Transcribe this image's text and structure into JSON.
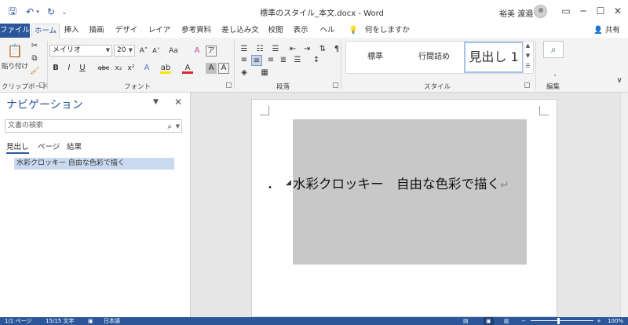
{
  "titlebar": {
    "title": "標準のスタイル_本文.docx  -  Word",
    "user": "裕美 渡邉",
    "min": "─",
    "max": "☐",
    "close": "✕",
    "qat_save": "🖫",
    "qat_undo": "↶",
    "qat_redo": "↻",
    "qat_more": "⌄"
  },
  "tabs": {
    "file": "ファイル",
    "home": "ホーム",
    "insert": "挿入",
    "draw": "描画",
    "design": "デザイン",
    "layout": "レイアウト",
    "references": "参考資料",
    "mailings": "差し込み文書",
    "review": "校閲",
    "view": "表示",
    "help": "ヘルプ",
    "tellme": "何をしますか",
    "share": "共有"
  },
  "ribbon": {
    "paste_label": "貼り付け",
    "clipboard": "クリップボード",
    "font_group": "フォント",
    "font_name": "メイリオ",
    "font_size": "20",
    "paragraph_group": "段落",
    "styles_group": "スタイル",
    "style_normal": "標準",
    "style_nospacing": "行間詰め",
    "style_heading1": "見出し 1",
    "editing": "編集",
    "grow": "A˄",
    "shrink": "A˅",
    "case": "Aa",
    "clear": "A",
    "bold": "B",
    "italic": "I",
    "underline": "U",
    "strike": "abc",
    "sub": "x₂",
    "sup": "x²"
  },
  "nav": {
    "title": "ナビゲーション",
    "search_placeholder": "文書の検索",
    "tab_headings": "見出し",
    "tab_pages": "ページ",
    "tab_results": "結果",
    "heading_item": "水彩クロッキー 自由な色彩で描く"
  },
  "document": {
    "bullet": "・",
    "heading_text": "水彩クロッキー　自由な色彩で描く",
    "para_mark": "↵"
  },
  "status": {
    "page": "1/1 ページ",
    "words": "15/15 文字",
    "language": "日本語",
    "zoom": "100%"
  },
  "colors": {
    "accent": "#2b579a",
    "shape_fill": "#c8c8c8",
    "nav_highlight": "#c8d9f0"
  }
}
